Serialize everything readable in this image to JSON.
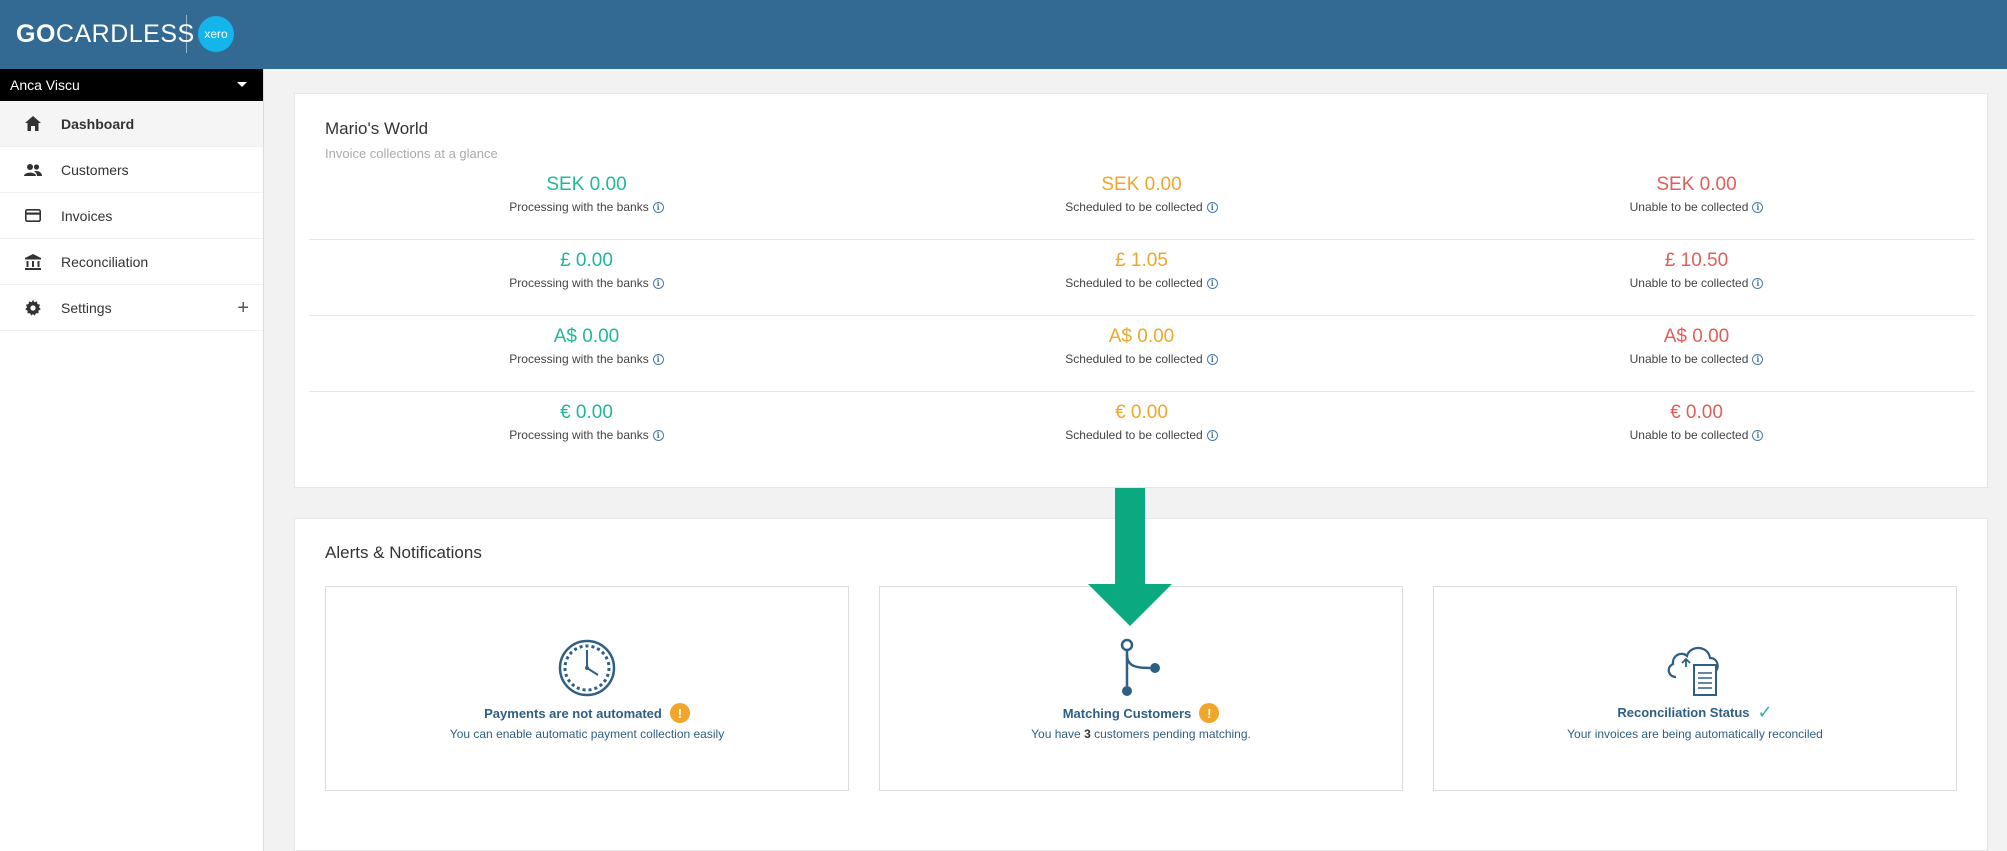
{
  "header": {
    "logo_go": "GO",
    "logo_rest": "CARDLESS",
    "xero_label": "xero"
  },
  "sidebar": {
    "account_name": "Anca Viscu",
    "items": [
      {
        "label": "Dashboard",
        "icon": "home-icon"
      },
      {
        "label": "Customers",
        "icon": "people-icon"
      },
      {
        "label": "Invoices",
        "icon": "card-icon"
      },
      {
        "label": "Reconciliation",
        "icon": "bank-icon"
      },
      {
        "label": "Settings",
        "icon": "gear-icon"
      }
    ]
  },
  "summary": {
    "title": "Mario's World",
    "subtitle": "Invoice collections at a glance",
    "labels": {
      "processing": "Processing with the banks",
      "scheduled": "Scheduled to be collected",
      "unable": "Unable to be collected"
    },
    "rows": [
      {
        "processing": "SEK 0.00",
        "scheduled": "SEK 0.00",
        "unable": "SEK 0.00"
      },
      {
        "processing": "£ 0.00",
        "scheduled": "£ 1.05",
        "unable": "£ 10.50"
      },
      {
        "processing": "A$ 0.00",
        "scheduled": "A$ 0.00",
        "unable": "A$ 0.00"
      },
      {
        "processing": "€ 0.00",
        "scheduled": "€ 0.00",
        "unable": "€ 0.00"
      }
    ],
    "colors": {
      "processing": "#1fb99a",
      "scheduled": "#f0a62a",
      "unable": "#e25e5a"
    }
  },
  "alerts": {
    "title": "Alerts & Notifications",
    "items": [
      {
        "title": "Payments are not automated",
        "status": "warning",
        "description": "You can enable automatic payment collection easily",
        "icon": "clock-icon"
      },
      {
        "title": "Matching Customers",
        "status": "warning",
        "description_prefix": "You have ",
        "description_count": "3",
        "description_suffix": " customers pending matching.",
        "icon": "branch-icon"
      },
      {
        "title": "Reconciliation Status",
        "status": "ok",
        "description": "Your invoices are being automatically reconciled",
        "icon": "cloud-document-icon"
      }
    ]
  },
  "accent": {
    "header": "#336a93",
    "arrow": "#0aa97f",
    "xero": "#13b5ea"
  }
}
